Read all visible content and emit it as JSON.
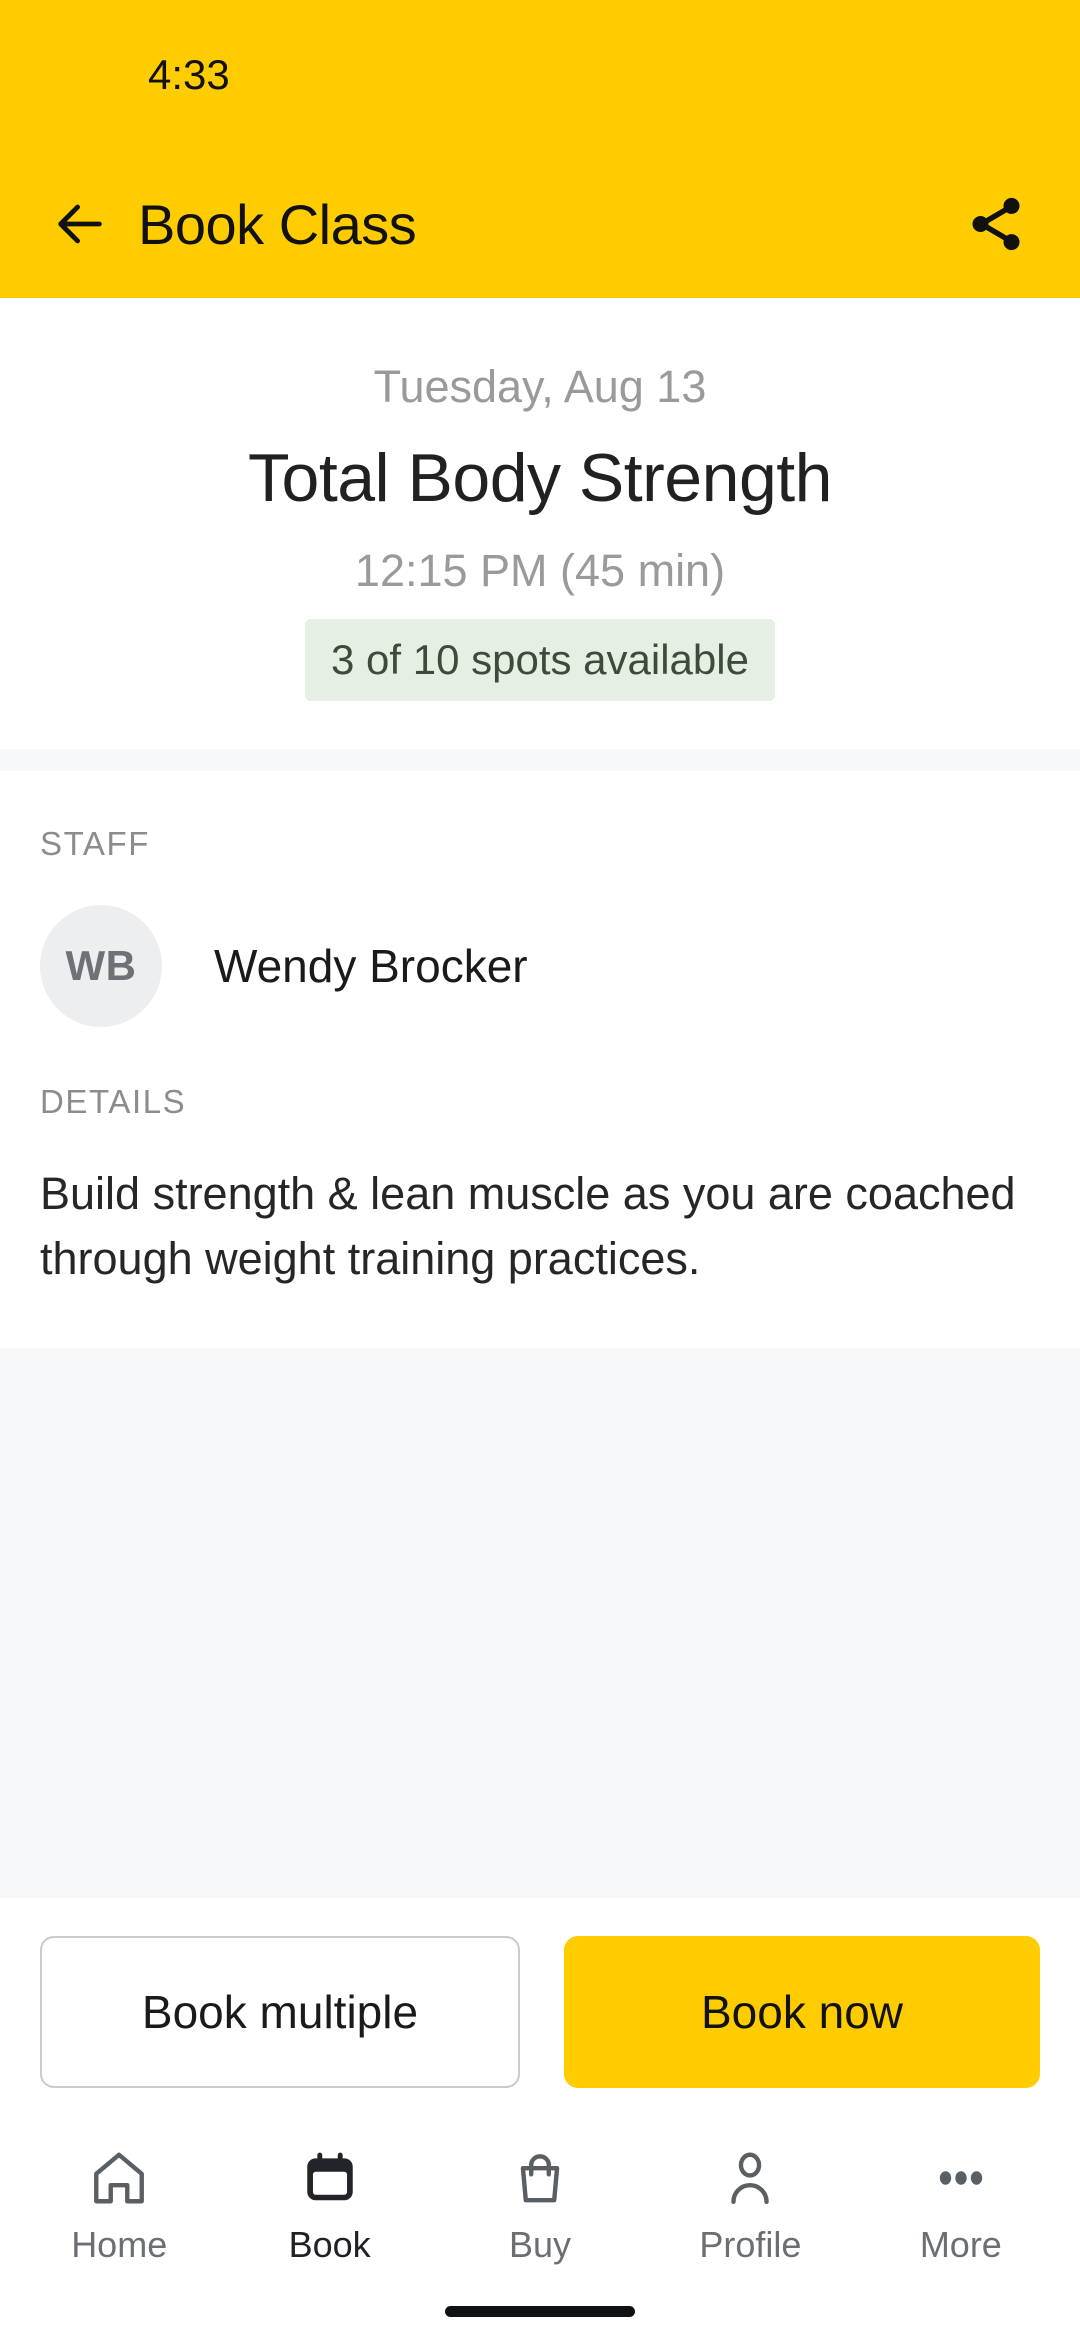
{
  "status_bar": {
    "time": "4:33"
  },
  "app_bar": {
    "title": "Book Class",
    "back_icon": "arrow-left-icon",
    "share_icon": "share-icon"
  },
  "hero": {
    "date": "Tuesday, Aug 13",
    "class_name": "Total Body Strength",
    "time_duration": "12:15 PM (45 min)",
    "spots_badge": "3 of 10 spots available"
  },
  "staff": {
    "section_label": "STAFF",
    "avatar_initials": "WB",
    "name": "Wendy Brocker"
  },
  "details": {
    "section_label": "DETAILS",
    "body": "Build strength & lean muscle as you are coached through weight training practices."
  },
  "actions": {
    "secondary_label": "Book multiple",
    "primary_label": "Book now"
  },
  "bottom_nav": {
    "items": [
      {
        "label": "Home",
        "icon": "home-icon",
        "active": false
      },
      {
        "label": "Book",
        "icon": "calendar-icon",
        "active": true
      },
      {
        "label": "Buy",
        "icon": "bag-icon",
        "active": false
      },
      {
        "label": "Profile",
        "icon": "person-icon",
        "active": false
      },
      {
        "label": "More",
        "icon": "ellipsis-icon",
        "active": false
      }
    ]
  },
  "colors": {
    "brand_yellow": "#FFCC00",
    "badge_green_bg": "#E5EFE3",
    "badge_green_text": "#3E4B3A",
    "surface_gray": "#F6F8FA",
    "text_primary": "#212121",
    "text_muted": "#9A9A9A"
  }
}
